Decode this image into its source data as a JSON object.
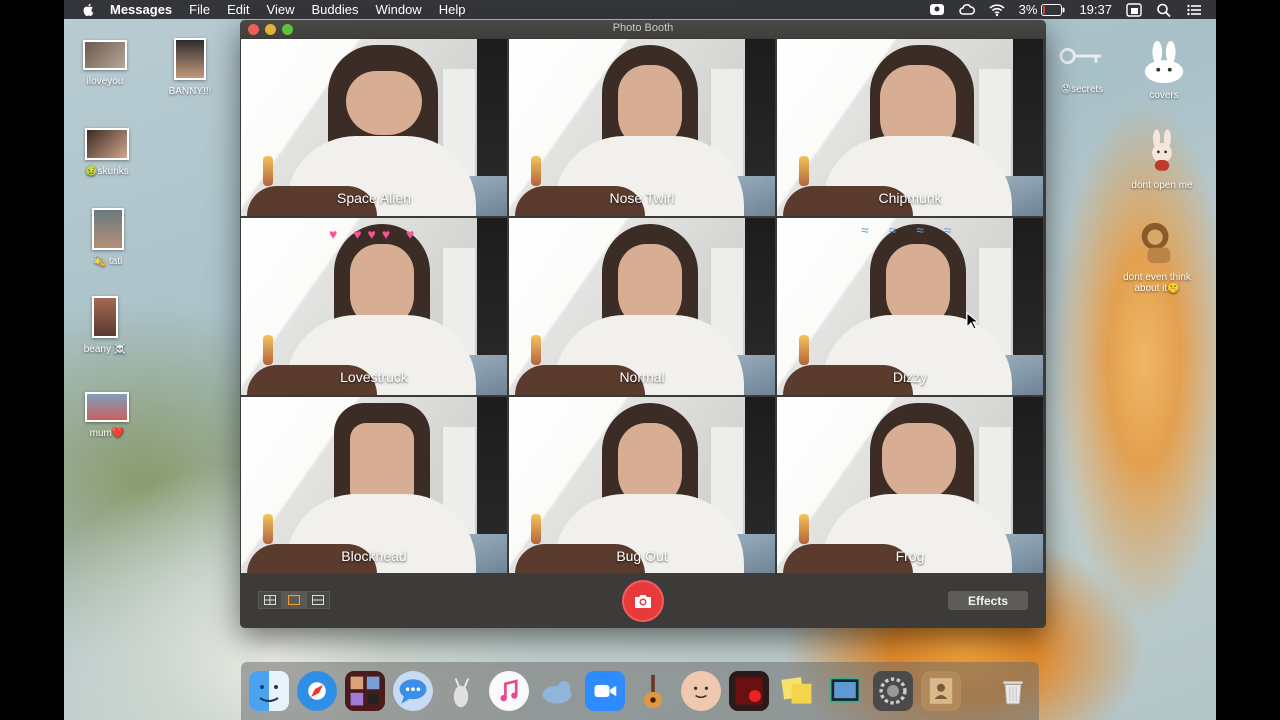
{
  "menubar": {
    "app_name": "Messages",
    "menus": [
      "File",
      "Edit",
      "View",
      "Buddies",
      "Window",
      "Help"
    ],
    "battery": "3%",
    "time": "19:37"
  },
  "desktop": {
    "icons_left": [
      {
        "label": "iloveyou"
      },
      {
        "label": "BANNY!!!"
      },
      {
        "label": "🤢skunks"
      },
      {
        "label": "💫 tati"
      },
      {
        "label": "beany ☠️"
      },
      {
        "label": "mum❤️"
      }
    ],
    "icons_right": [
      {
        "label": "😟secrets"
      },
      {
        "label": "covers"
      },
      {
        "label": "dont open me"
      },
      {
        "label": "dont even think about it🤫"
      }
    ]
  },
  "window": {
    "title": "Photo Booth",
    "effects": [
      "Space Alien",
      "Nose Twirl",
      "Chipmunk",
      "Lovestruck",
      "Normal",
      "Dizzy",
      "Blockhead",
      "Bug Out",
      "Frog"
    ],
    "effects_button": "Effects"
  },
  "dock": {
    "apps": [
      "finder-icon",
      "safari-icon",
      "photo-booth-icon",
      "messages-icon",
      "launchpad-icon",
      "itunes-icon",
      "sequel-pro-icon",
      "zoom-icon",
      "garageband-icon",
      "face-icon",
      "photo-booth-red-icon",
      "stickies-icon",
      "preview-icon",
      "system-preferences-icon",
      "contacts-icon"
    ],
    "trash": "trash-icon"
  }
}
